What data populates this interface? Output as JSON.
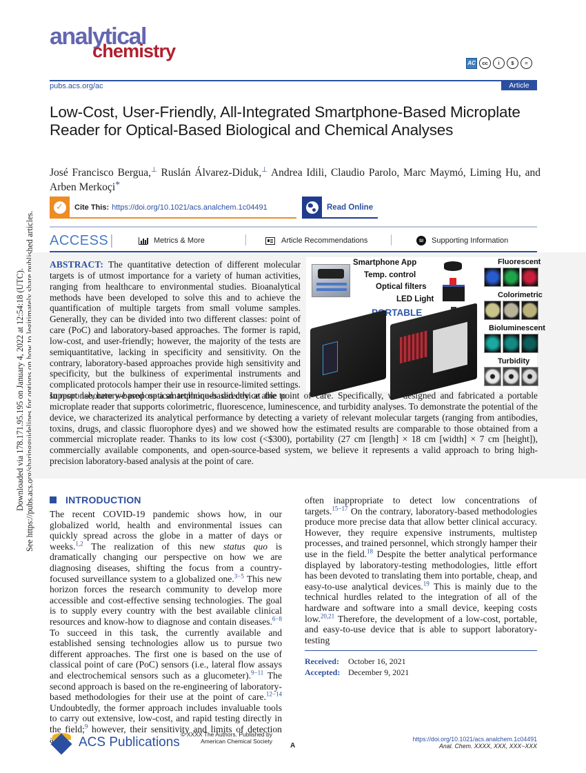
{
  "sidebar_stamp": {
    "line1": "Downloaded via 178.171.95.195 on January 4, 2022 at 12:54:18 (UTC).",
    "line2": "See https://pubs.acs.org/sharingguidelines for options on how to legitimately share published articles."
  },
  "journal": {
    "logo_line1": "analytical",
    "logo_line2": "chemistry",
    "url": "pubs.acs.org/ac",
    "article_type": "Article",
    "license_icons": [
      "acs-authorchoice-icon",
      "cc-icon",
      "by-icon",
      "nc-icon",
      "nd-icon"
    ],
    "license_labels": {
      "ac": "AC",
      "cc": "cc",
      "by": "i",
      "nc": "$",
      "nd": "="
    }
  },
  "title": "Low-Cost, User-Friendly, All-Integrated Smartphone-Based Microplate Reader for Optical-Based Biological and Chemical Analyses",
  "authors": [
    {
      "name": "José Francisco Bergua,",
      "mark": "⊥"
    },
    {
      "name": "Ruslán Álvarez-Diduk,",
      "mark": "⊥"
    },
    {
      "name": "Andrea Idili,",
      "mark": ""
    },
    {
      "name": "Claudio Parolo,",
      "mark": ""
    },
    {
      "name": "Marc Maymó,",
      "mark": ""
    },
    {
      "name": "Liming Hu,",
      "mark": ""
    },
    {
      "name": "and Arben Merkoçi",
      "mark": "*"
    }
  ],
  "cite": {
    "label": "Cite This:",
    "doi": "https://doi.org/10.1021/acs.analchem.1c04491",
    "check_glyph": "✓",
    "read_online": "Read Online"
  },
  "access": {
    "label": "ACCESS",
    "pipe": "|",
    "metrics": "Metrics & More",
    "recommendations": "Article Recommendations",
    "supporting": "Supporting Information",
    "si_badge": "SI"
  },
  "abstract": {
    "label": "ABSTRACT:",
    "wrapped_text": "The quantitative detection of different molecular targets is of utmost importance for a variety of human activities, ranging from healthcare to environmental studies. Bioanalytical methods have been developed to solve this and to achieve the quantification of multiple targets from small volume samples. Generally, they can be divided into two different classes: point of care (PoC) and laboratory-based approaches. The former is rapid, low-cost, and user-friendly; however, the majority of the tests are semiquantitative, lacking in specificity and sensitivity. On the contrary, laboratory-based approaches provide high sensitivity and specificity, but the bulkiness of experimental instruments and complicated protocols hamper their use in resource-limited settings. In response, here we propose a smartphone-based device able to",
    "full_text": "support laboratory-based optical techniques directly at the point of care. Specifically, we designed and fabricated a portable microplate reader that supports colorimetric, fluorescence, luminescence, and turbidity analyses. To demonstrate the potential of the device, we characterized its analytical performance by detecting a variety of relevant molecular targets (ranging from antibodies, toxins, drugs, and classic fluorophore dyes) and we showed how the estimated results are comparable to those obtained from a commercial microplate reader. Thanks to its low cost (<$300), portability (27 cm [length] × 18 cm [width] × 7 cm [height]), commercially available components, and open-source-based system, we believe it represents a valid approach to bring high-precision laboratory-based analysis at the point of care."
  },
  "toc_graphic": {
    "labels": [
      "Smartphone App",
      "Temp. control",
      "Optical filters",
      "LED Light"
    ],
    "portable": "PORTABLE",
    "modes": [
      {
        "name": "Fluorescent",
        "colors": [
          "#2a5ad0",
          "#1fa44a",
          "#c81e3c"
        ]
      },
      {
        "name": "Colorimetric",
        "colors": [
          "#c8c48a",
          "#b8b29a",
          "#bab27a"
        ]
      },
      {
        "name": "Bioluminescent",
        "colors": [
          "#1aa8a0",
          "#128a84",
          "#0d5e5a"
        ]
      },
      {
        "name": "Turbidity",
        "colors": [
          "#e8e8e8",
          "#e0e0e0",
          "#d8d8d8"
        ]
      }
    ]
  },
  "introduction": {
    "heading": "INTRODUCTION",
    "left_html": [
      {
        "t": "The recent COVID-19 pandemic shows how, in our globalized world, health and environmental issues can quickly spread across the globe in a matter of days or weeks."
      },
      {
        "sup": "1,2"
      },
      {
        "t": " The realization of this new "
      },
      {
        "em": "status quo"
      },
      {
        "t": " is dramatically changing our perspective on how we are diagnosing diseases, shifting the focus from a country-focused surveillance system to a globalized one."
      },
      {
        "sup": "3−5"
      },
      {
        "t": " This new horizon forces the research community to develop more accessible and cost-effective sensing technologies. The goal is to supply every country with the best available clinical resources and know-how to diagnose and contain diseases."
      },
      {
        "sup": "6−8"
      },
      {
        "t": " To succeed in this task, the currently available and established sensing technologies allow us to pursue two different approaches. The first one is based on the use of classical point of care (PoC) sensors (i.e., lateral flow assays and electrochemical sensors such as a glucometer)."
      },
      {
        "sup": "9−11"
      },
      {
        "t": " The second approach is based on the re-engineering of laboratory-based methodologies for their use at the point of care."
      },
      {
        "sup": "12−14"
      },
      {
        "t": " Undoubtedly, the former approach includes invaluable tools to carry out extensive, low-cost, and rapid testing directly in the field;"
      },
      {
        "sup": "9"
      },
      {
        "t": " however, their sensitivity and limits of detection are"
      }
    ],
    "right_html": [
      {
        "t": "often inappropriate to detect low concentrations of targets."
      },
      {
        "sup": "15−17"
      },
      {
        "t": " On the contrary, laboratory-based methodologies produce more precise data that allow better clinical accuracy. However, they require expensive instruments, multistep processes, and trained personnel, which strongly hamper their use in the field."
      },
      {
        "sup": "18"
      },
      {
        "t": " Despite the better analytical performance displayed by laboratory-testing methodologies, little effort has been devoted to translating them into portable, cheap, and easy-to-use analytical devices."
      },
      {
        "sup": "19"
      },
      {
        "t": " This is mainly due to the technical hurdles related to the integration of all of the hardware and software into a small device, keeping costs low."
      },
      {
        "sup": "20,21"
      },
      {
        "t": " Therefore, the development of a low-cost, portable, and easy-to-use device that is able to support laboratory-testing"
      }
    ]
  },
  "dates": {
    "received_label": "Received:",
    "received": "October 16, 2021",
    "accepted_label": "Accepted:",
    "accepted": "December 9, 2021"
  },
  "footer": {
    "publisher": "ACS Publications",
    "copyright_line1": "© XXXX The Authors. Published by",
    "copyright_line2": "American Chemical Society",
    "page": "A",
    "doi": "https://doi.org/10.1021/acs.analchem.1c04491",
    "citation": "Anal. Chem. XXXX, XXX, XXX−XXX"
  },
  "colors": {
    "accent_blue": "#2b4fa0",
    "logo_purple": "#6466b0",
    "logo_red": "#b0202e",
    "cite_orange": "#ee8b23",
    "abstract_bg": "#f3f3f3"
  }
}
